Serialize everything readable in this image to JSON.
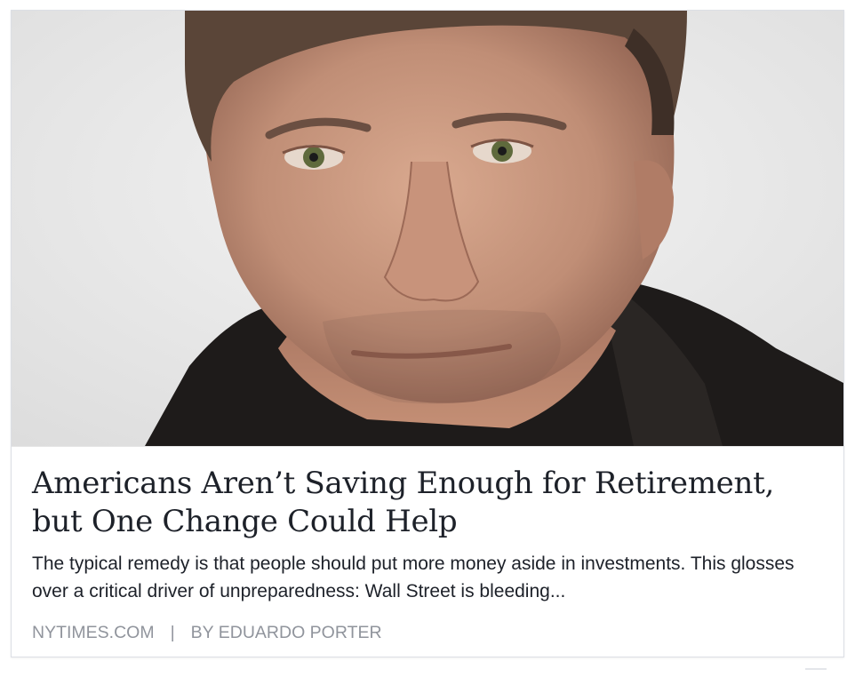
{
  "link_preview": {
    "image": {
      "icon": "author-portrait-photo",
      "background_color": "#ececec",
      "jacket_color": "#1e1b1a",
      "skin_color": "#c08e76",
      "hair_color": "#5a4538"
    },
    "headline": "Americans Aren’t Saving Enough for Retirement, but One Change Could Help",
    "description": "The typical remedy is that people should put more money aside in investments. This glosses over a critical driver of unpreparedness: Wall Street is bleeding...",
    "source": "NYTIMES.COM",
    "separator": "|",
    "byline": "BY EDUARDO PORTER",
    "colors": {
      "headline": "#1d2129",
      "meta": "#90949c",
      "border": "#dcdfe5"
    }
  }
}
